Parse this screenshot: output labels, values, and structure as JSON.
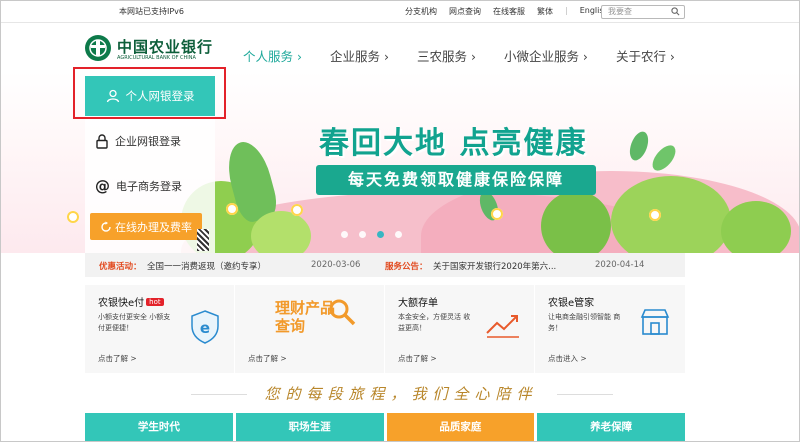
{
  "topbar": {
    "ipv6": "本网站已支持IPv6",
    "links": [
      "分支机构",
      "网点查询",
      "在线客服",
      "繁体",
      "English"
    ],
    "search_placeholder": "我要查"
  },
  "logo": {
    "cn": "中国农业银行",
    "en": "AGRICULTURAL BANK OF CHINA"
  },
  "nav": [
    "个人服务 ›",
    "企业服务 ›",
    "三农服务 ›",
    "小微企业服务 ›",
    "关于农行 ›"
  ],
  "login": {
    "personal": "个人网银登录",
    "corporate": "企业网银登录",
    "ecommerce": "电子商务登录",
    "online": "在线办理及费率"
  },
  "banner": {
    "heading": "春回大地 点亮健康",
    "ribbon": "每天免费领取健康保险保障",
    "slide_count": 4,
    "active_slide": 3
  },
  "news": {
    "promo_label": "优惠活动：",
    "promo_text": "全国一一消费返现（邀约专享）",
    "promo_date": "2020-03-06",
    "notice_label": "服务公告：",
    "notice_text": "关于国家开发银行2020年第六...",
    "notice_date": "2020-04-14"
  },
  "cards": [
    {
      "title": "农银快e付",
      "badge": "hot",
      "desc": "小额支付更安全 小额支付更便捷！",
      "more": "点击了解 >"
    },
    {
      "title": "理财产品查询",
      "more": "点击了解 >"
    },
    {
      "title": "大额存单",
      "desc": "本金安全，方便灵活 收益更高！",
      "more": "点击了解 >"
    },
    {
      "title": "农银e管家",
      "desc": "让电商金融引领智能 商务！",
      "more": "点击进入 >"
    }
  ],
  "slogan": "您的每段旅程，我们全心陪伴",
  "tabs": [
    "学生时代",
    "职场生涯",
    "品质家庭",
    "养老保障"
  ],
  "colors": {
    "teal": "#33c6b8",
    "orange": "#f7a12a",
    "red": "#e3222a",
    "green": "#0d5e3a"
  }
}
